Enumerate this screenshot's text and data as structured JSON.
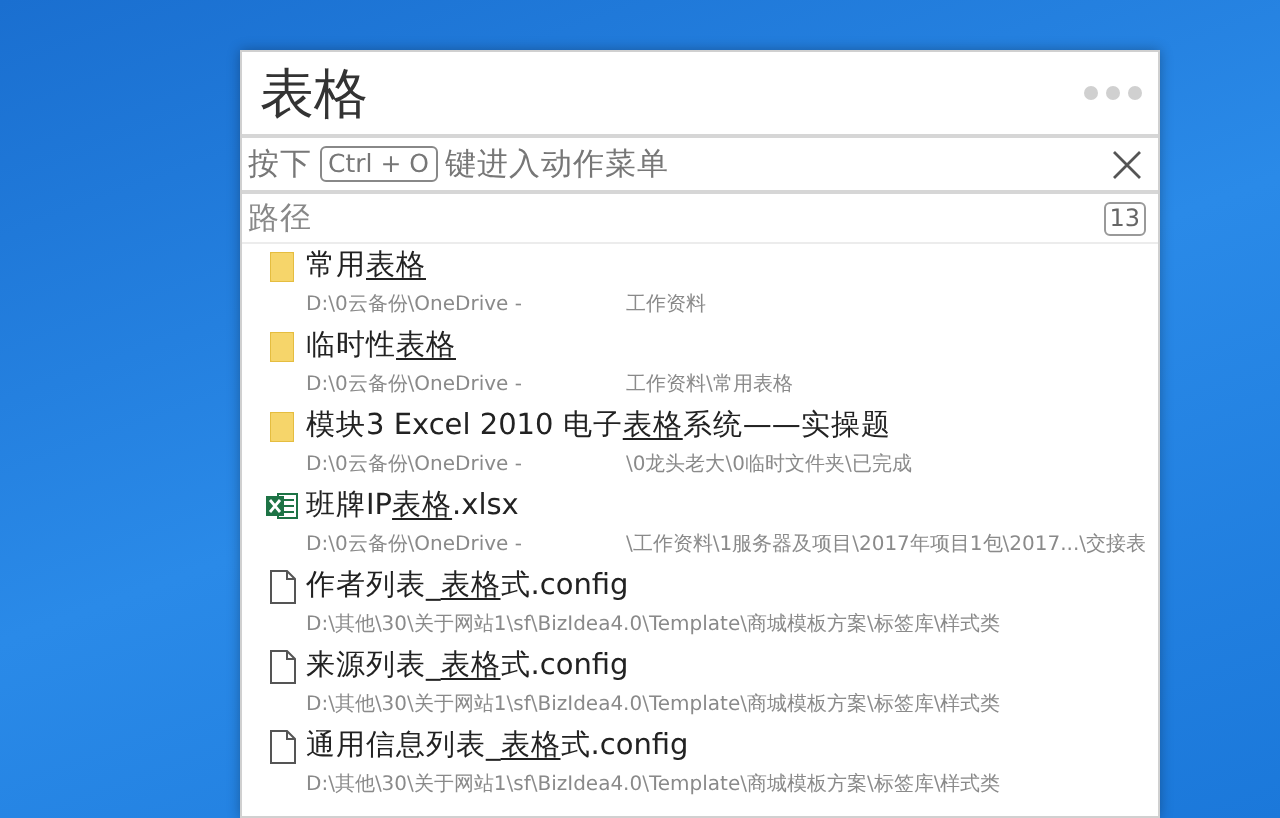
{
  "window": {
    "title": "表格"
  },
  "search": {
    "prefix": "按下",
    "key": "Ctrl + O",
    "suffix": "键进入动作菜单"
  },
  "header": {
    "label": "路径",
    "count": "13"
  },
  "results": [
    {
      "kind": "folder",
      "before": "常用",
      "match": "表格",
      "path_head": "D:\\0云备份\\OneDrive -",
      "path_tail": "工作资料"
    },
    {
      "kind": "folder",
      "before": "临时性",
      "match": "表格",
      "path_head": "D:\\0云备份\\OneDrive -",
      "path_tail": "工作资料\\常用表格"
    },
    {
      "kind": "folder",
      "before": "模块3 Excel 2010 电子",
      "match": "表格",
      "after": "系统——实操题",
      "path_head": "D:\\0云备份\\OneDrive -",
      "path_tail": "\\0龙头老大\\0临时文件夹\\已完成"
    },
    {
      "kind": "excel",
      "before": "班牌IP",
      "match": "表格",
      "after": ".xlsx",
      "path_head": "D:\\0云备份\\OneDrive -",
      "path_tail": "\\工作资料\\1服务器及项目\\2017年项目1包\\2017...\\交接表"
    },
    {
      "kind": "file",
      "before": "作者列表_",
      "match": "表格",
      "after": "式.config",
      "path_head": "D:\\其他\\30\\关于网站1\\sf\\BizIdea4.0\\Template\\商城模板方案\\标签库\\样式类"
    },
    {
      "kind": "file",
      "before": "来源列表_",
      "match": "表格",
      "after": "式.config",
      "path_head": "D:\\其他\\30\\关于网站1\\sf\\BizIdea4.0\\Template\\商城模板方案\\标签库\\样式类"
    },
    {
      "kind": "file",
      "before": "通用信息列表_",
      "match": "表格",
      "after": "式.config",
      "path_head": "D:\\其他\\30\\关于网站1\\sf\\BizIdea4.0\\Template\\商城模板方案\\标签库\\样式类"
    }
  ]
}
